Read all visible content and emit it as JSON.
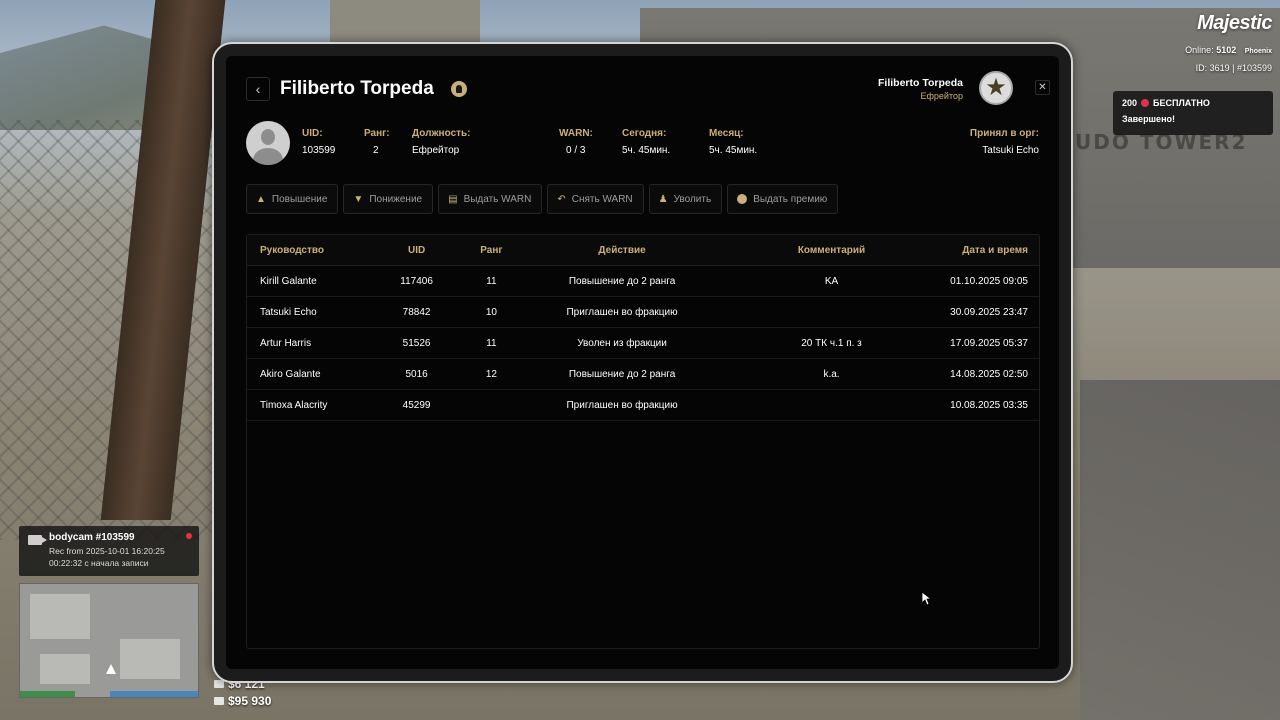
{
  "hud": {
    "logo": "Majestic",
    "online_label": "Online:",
    "online_value": "5102",
    "server": "Phoenix",
    "id_line": "ID: 3619 | #103599",
    "notify_title": "200 • БЕСПЛАТНО",
    "notify_title_prefix": "200",
    "notify_title_suffix": "БЕСПЛАТНО",
    "notify_status": "Завершено!"
  },
  "bodycam": {
    "title": "bodycam #103599",
    "rec_from": "Rec from 2025-10-01 16:20:25",
    "elapsed": "00:22:32 с начала записи"
  },
  "money": {
    "cash": "$6 121",
    "bank": "$95 930"
  },
  "profile": {
    "name": "Filiberto Torpeda",
    "labels": {
      "uid": "UID:",
      "rank": "Ранг:",
      "position": "Должность:",
      "warn": "WARN:",
      "today": "Сегодня:",
      "month": "Месяц:",
      "accepted_by": "Принял в орг:"
    },
    "values": {
      "uid": "103599",
      "rank": "2",
      "position": "Ефрейтор",
      "warn": "0 / 3",
      "today": "5ч. 45мин.",
      "month": "5ч. 45мин.",
      "accepted_by": "Tatsuki Echo"
    }
  },
  "header_user": {
    "name": "Filiberto Torpeda",
    "rank": "Ефрейтор"
  },
  "actions": [
    {
      "label": "Повышение",
      "icon": "chevron-up-icon"
    },
    {
      "label": "Понижение",
      "icon": "chevron-down-icon"
    },
    {
      "label": "Выдать WARN",
      "icon": "warn-doc-icon"
    },
    {
      "label": "Снять WARN",
      "icon": "undo-icon"
    },
    {
      "label": "Уволить",
      "icon": "fire-person-icon"
    },
    {
      "label": "Выдать премию",
      "icon": "coin-icon"
    }
  ],
  "table": {
    "headers": [
      "Руководство",
      "UID",
      "Ранг",
      "Действие",
      "Комментарий",
      "Дата и время"
    ],
    "rows": [
      [
        "Kirill Galante",
        "117406",
        "11",
        "Повышение до 2 ранга",
        "KA",
        "01.10.2025 09:05"
      ],
      [
        "Tatsuki Echo",
        "78842",
        "10",
        "Приглашен во фракцию",
        "",
        "30.09.2025 23:47"
      ],
      [
        "Artur Harris",
        "51526",
        "11",
        "Уволен из фракции",
        "20 ТК ч.1 п. з",
        "17.09.2025 05:37"
      ],
      [
        "Akiro Galante",
        "5016",
        "12",
        "Повышение до 2 ранга",
        "k.a.",
        "14.08.2025 02:50"
      ],
      [
        "Timoxa Alacrity",
        "45299",
        "",
        "Приглашен во фракцию",
        "",
        "10.08.2025 03:35"
      ]
    ]
  },
  "colors": {
    "accent_gold": "#c9b07a",
    "screen_bg": "#050505",
    "rec_red": "#e83434"
  }
}
